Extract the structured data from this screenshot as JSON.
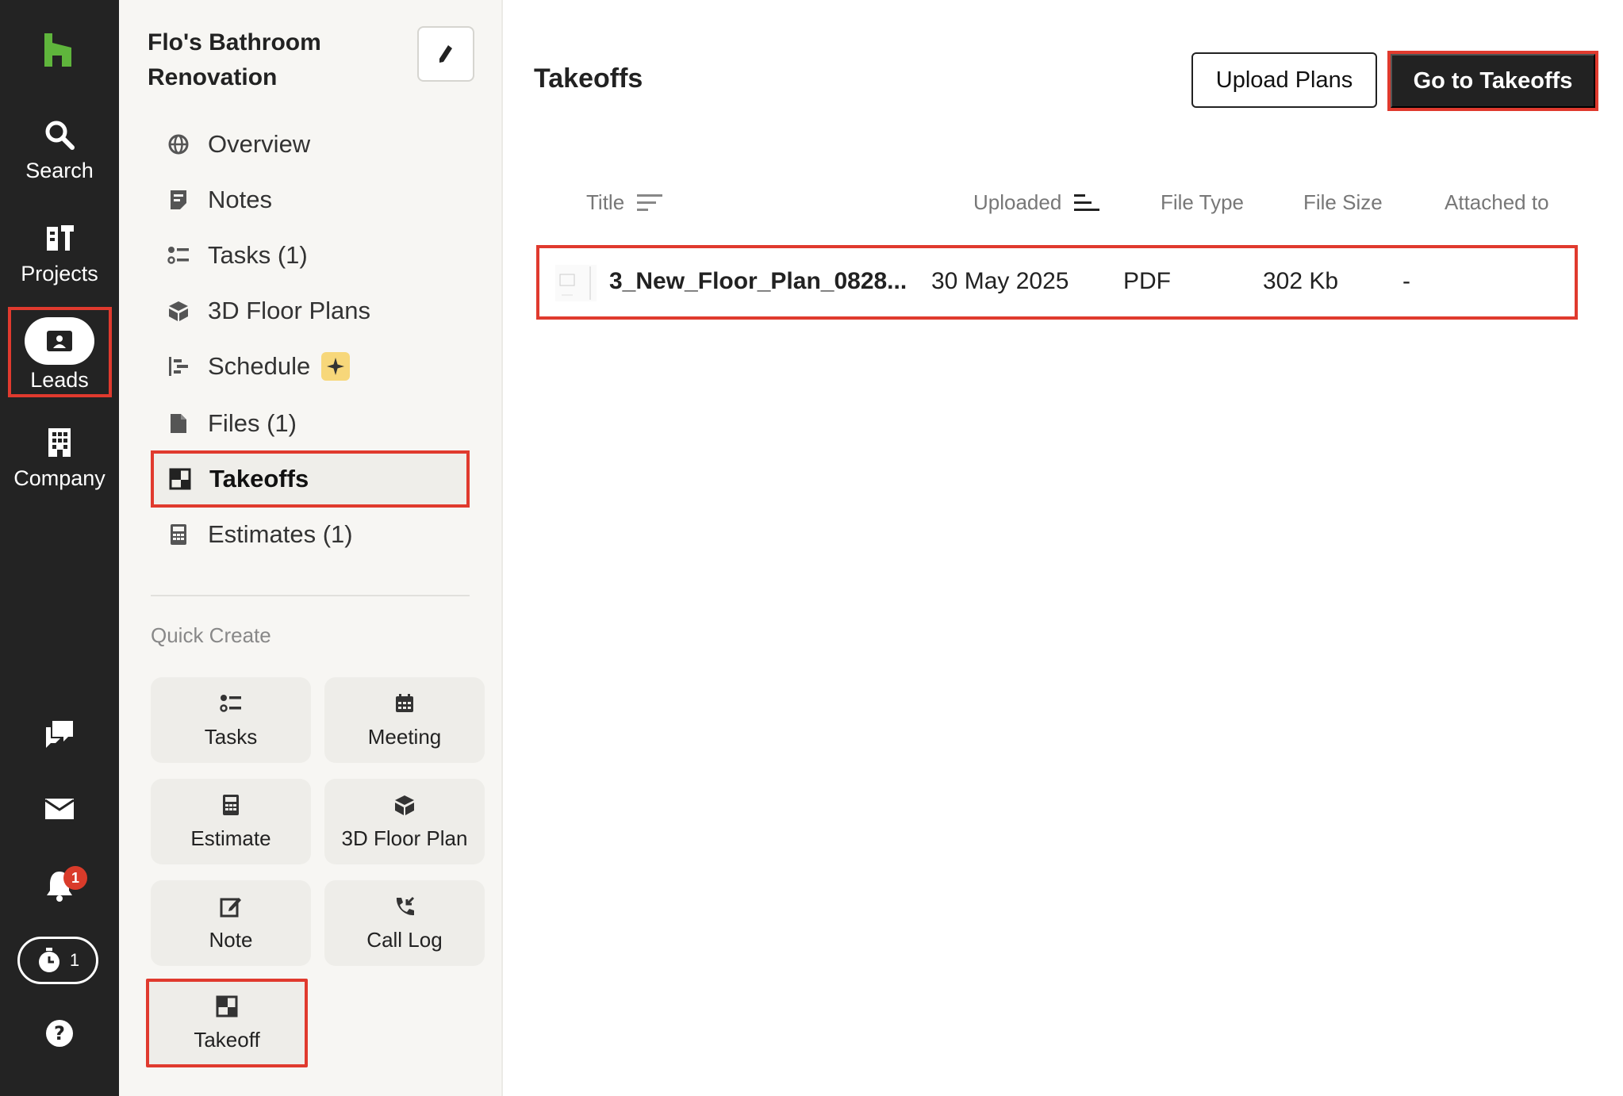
{
  "rail": {
    "items": [
      {
        "label": "Search",
        "icon": "search-icon"
      },
      {
        "label": "Projects",
        "icon": "projects-icon"
      },
      {
        "label": "Leads",
        "icon": "leads-icon"
      },
      {
        "label": "Company",
        "icon": "company-icon"
      }
    ],
    "notification_count": "1",
    "timer_count": "1"
  },
  "project": {
    "title": "Flo's Bathroom Renovation",
    "nav": [
      {
        "label": "Overview",
        "icon": "globe-icon"
      },
      {
        "label": "Notes",
        "icon": "notes-icon"
      },
      {
        "label": "Tasks (1)",
        "icon": "tasks-icon"
      },
      {
        "label": "3D Floor Plans",
        "icon": "cube-icon"
      },
      {
        "label": "Schedule",
        "icon": "schedule-icon"
      },
      {
        "label": "Files (1)",
        "icon": "file-icon"
      },
      {
        "label": "Takeoffs",
        "icon": "takeoff-icon"
      },
      {
        "label": "Estimates (1)",
        "icon": "calculator-icon"
      }
    ],
    "quick_create_label": "Quick Create",
    "quick_create": [
      {
        "label": "Tasks",
        "icon": "tasks-icon"
      },
      {
        "label": "Meeting",
        "icon": "calendar-icon"
      },
      {
        "label": "Estimate",
        "icon": "calculator-icon"
      },
      {
        "label": "3D Floor Plan",
        "icon": "cube-icon"
      },
      {
        "label": "Note",
        "icon": "note-edit-icon"
      },
      {
        "label": "Call Log",
        "icon": "phone-icon"
      },
      {
        "label": "Takeoff",
        "icon": "takeoff-icon"
      }
    ]
  },
  "main": {
    "title": "Takeoffs",
    "upload_label": "Upload Plans",
    "goto_label": "Go to Takeoffs",
    "columns": [
      "Title",
      "Uploaded",
      "File Type",
      "File Size",
      "Attached to"
    ],
    "rows": [
      {
        "title": "3_New_Floor_Plan_0828...",
        "uploaded": "30 May 2025",
        "type": "PDF",
        "size": "302 Kb",
        "attached": "-"
      }
    ]
  },
  "colors": {
    "accent": "#e03a2e",
    "rail": "#232323",
    "logo": "#5fb53c"
  }
}
